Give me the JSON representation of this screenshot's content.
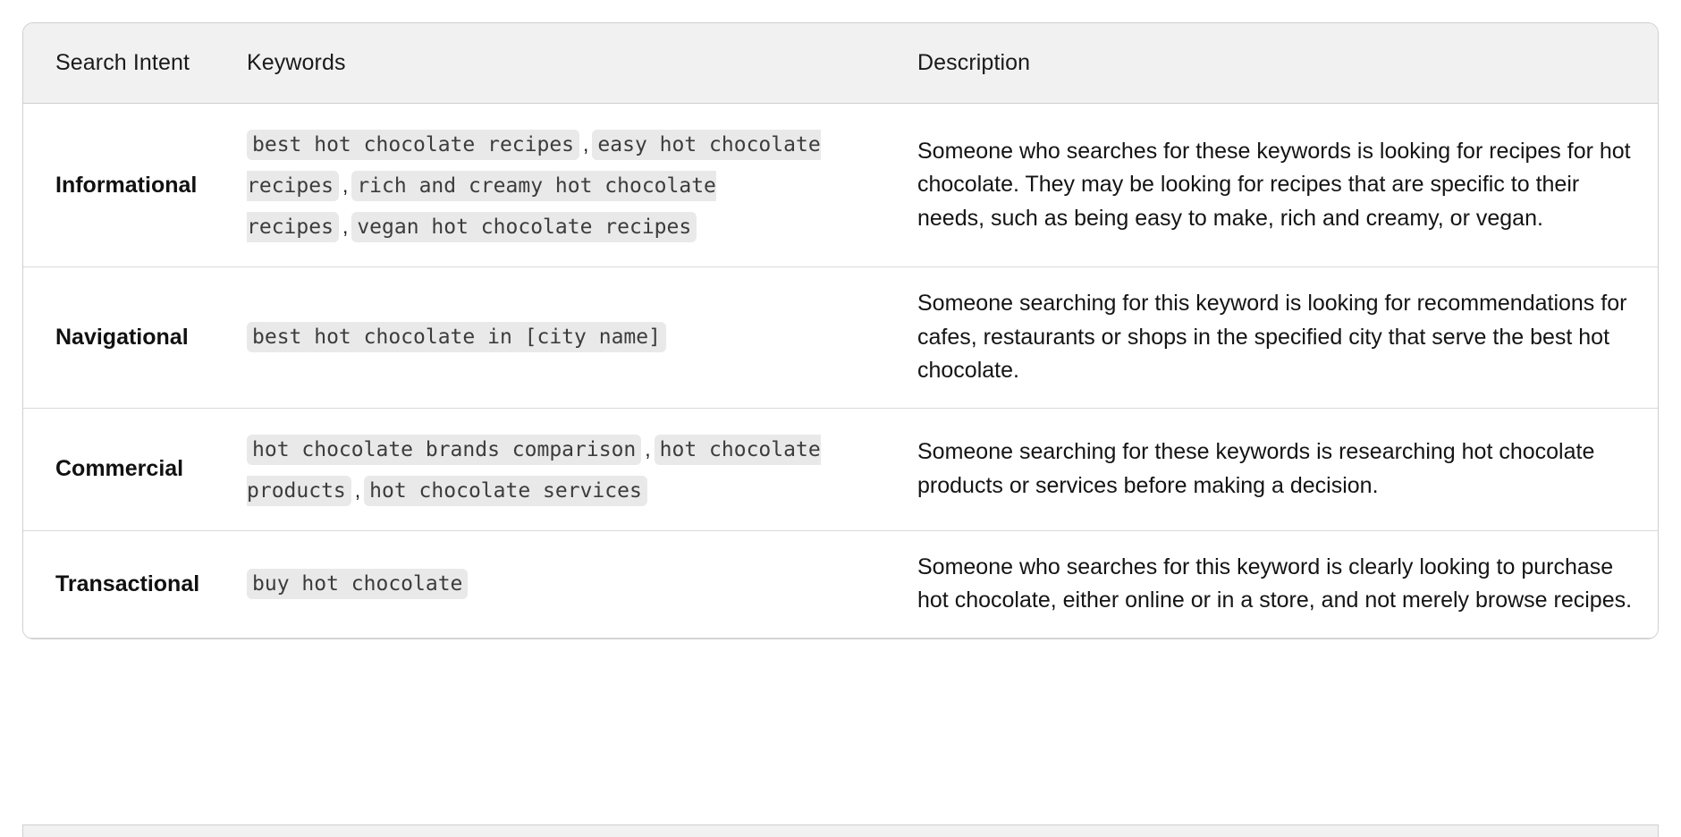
{
  "table": {
    "columns": [
      {
        "key": "search_intent",
        "label": "Search Intent"
      },
      {
        "key": "keywords",
        "label": "Keywords"
      },
      {
        "key": "description",
        "label": "Description"
      }
    ],
    "separator": ",",
    "rows": [
      {
        "intent": "Informational",
        "keywords": [
          "best hot chocolate recipes",
          "easy hot chocolate recipes",
          "rich and creamy hot chocolate recipes",
          "vegan hot chocolate recipes"
        ],
        "description": "Someone who searches for these keywords is looking for recipes for hot chocolate. They may be looking for recipes that are specific to their needs, such as being easy to make, rich and creamy, or vegan."
      },
      {
        "intent": "Navigational",
        "keywords": [
          "best hot chocolate in [city name]"
        ],
        "description": "Someone searching for this keyword is looking for recommendations for cafes, restaurants or shops in the specified city that serve the best hot chocolate."
      },
      {
        "intent": "Commercial",
        "keywords": [
          "hot chocolate brands comparison",
          "hot chocolate products",
          "hot chocolate services"
        ],
        "description": "Someone searching for these keywords is researching hot chocolate products or services before making a decision."
      },
      {
        "intent": "Transactional",
        "keywords": [
          "buy hot chocolate"
        ],
        "description": "Someone who searches for this keyword is clearly looking to purchase hot chocolate, either online or in a store, and not merely browse recipes."
      }
    ]
  },
  "colors": {
    "header_background": "#f1f1f1",
    "code_chip_background": "#e9e9e9",
    "code_chip_text": "#3c3c3c",
    "border": "#cfcfcf",
    "row_divider": "#d9d9d9",
    "text": "#141414",
    "page_background": "#ffffff"
  }
}
